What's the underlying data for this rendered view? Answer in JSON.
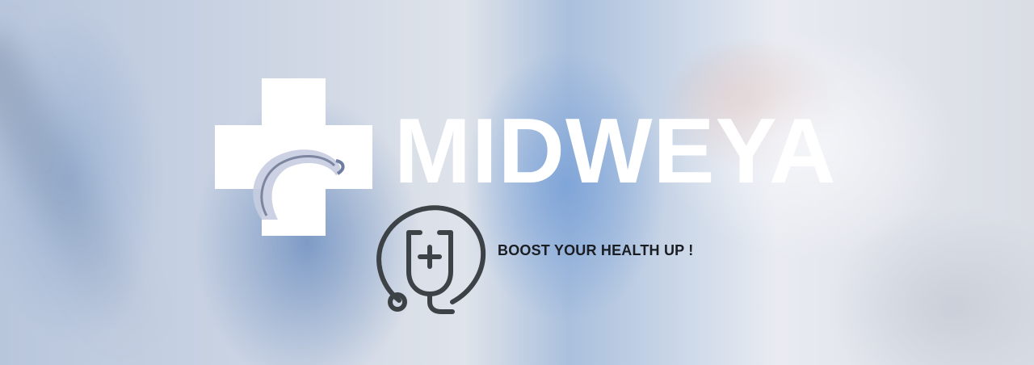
{
  "hero": {
    "brand": "MIDWEYA",
    "tagline": "BOOST YOUR HEALTH UP !",
    "logo_icon": "medical-cross-logo-icon",
    "badge_icon": "stethoscope-plus-icon"
  },
  "colors": {
    "brand_text": "#ffffff",
    "tagline_text": "#1a1d22",
    "icon_stroke": "#3d4247"
  }
}
